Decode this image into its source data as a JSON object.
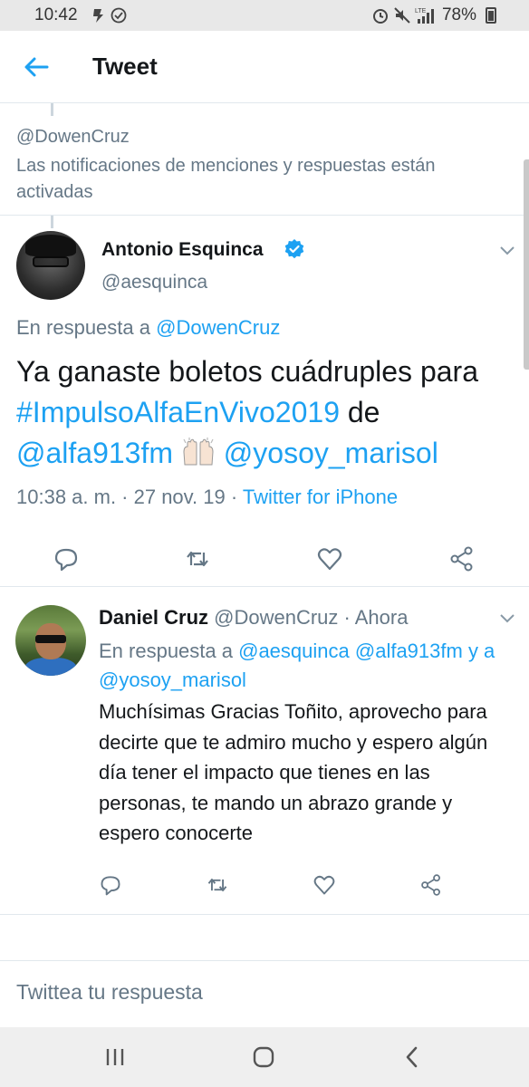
{
  "status_bar": {
    "time": "10:42",
    "battery": "78%",
    "network": "LTE"
  },
  "header": {
    "title": "Tweet"
  },
  "notification": {
    "handle": "@DowenCruz",
    "text": "Las notificaciones de menciones y respuestas están activadas"
  },
  "main_tweet": {
    "name": "Antonio Esquinca",
    "handle": "@aesquinca",
    "reply_prefix": "En respuesta a ",
    "reply_to": "@DowenCruz",
    "text_part1": "Ya ganaste boletos cuádruples para ",
    "hashtag": "#ImpulsoAlfaEnVivo2019",
    "text_part2": " de ",
    "mention1": "@alfa913fm",
    "mention2": "@yosoy_marisol",
    "meta_time": "10:38 a. m. · 27 nov. 19 · ",
    "meta_source": "Twitter for iPhone"
  },
  "reply_tweet": {
    "name": "Daniel Cruz",
    "handle": " @DowenCruz · Ahora",
    "reply_prefix": "En respuesta a ",
    "mention1": "@aesquinca",
    "mention2": "@alfa913fm",
    "joiner": " y a ",
    "mention3": "@yosoy_marisol",
    "text": "Muchísimas Gracias Toñito, aprovecho para decirte que te admiro mucho y espero algún día tener el impacto que tienes en las personas, te mando un abrazo grande y espero conocerte"
  },
  "compose": {
    "placeholder": "Twittea tu respuesta"
  },
  "colors": {
    "accent": "#1da1f2",
    "secondary_text": "#657786",
    "primary_text": "#14171a"
  },
  "icons": {
    "back": "arrow-left-icon",
    "verified": "verified-badge-icon",
    "reply": "reply-icon",
    "retweet": "retweet-icon",
    "like": "heart-icon",
    "share": "share-icon",
    "more": "chevron-down-icon"
  }
}
